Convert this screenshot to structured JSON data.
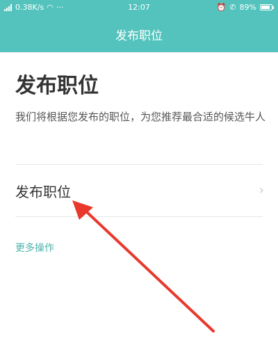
{
  "status_bar": {
    "network_speed": "0.38K/s",
    "dots": "···",
    "time": "12:07",
    "battery": "89%",
    "battery_level": 0.89
  },
  "title_bar": {
    "title": "发布职位"
  },
  "main": {
    "heading": "发布职位",
    "description": "我们将根据您发布的职位，为您推荐最合适的候选牛人",
    "row_label": "发布职位",
    "more_link": "更多操作"
  },
  "colors": {
    "header_bg": "#54c3bd",
    "link": "#4db3ad",
    "annotation_arrow": "#e8392c"
  },
  "icons": [
    "signal-icon",
    "wifi-icon",
    "alarm-icon",
    "phone-icon",
    "battery-icon",
    "chevron-right-icon"
  ]
}
